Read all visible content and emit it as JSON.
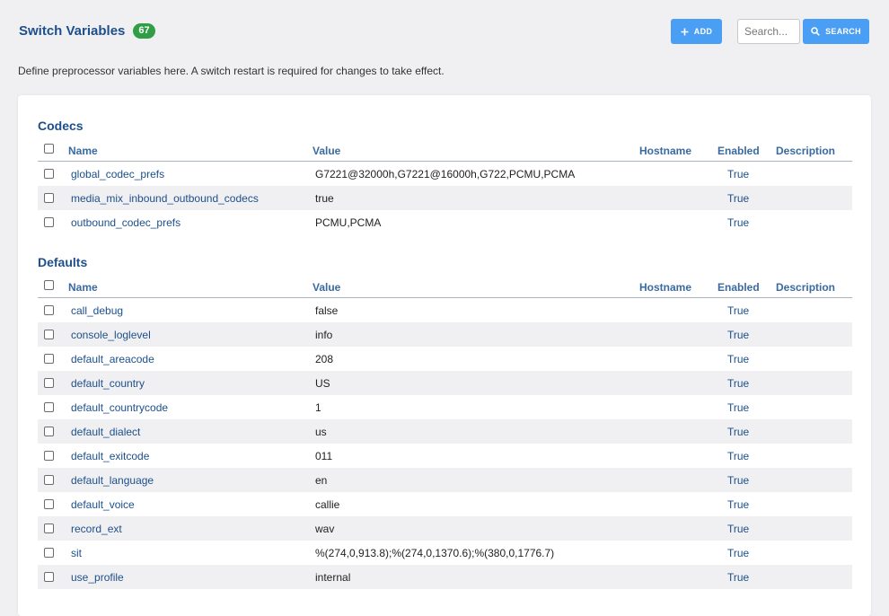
{
  "page": {
    "title": "Switch Variables",
    "count": "67",
    "description": "Define preprocessor variables here. A switch restart is required for changes to take effect."
  },
  "toolbar": {
    "add_label": "ADD",
    "search_placeholder": "Search...",
    "search_value": "",
    "search_label": "SEARCH",
    "accent_color": "#4a9ff5"
  },
  "columns": {
    "name": "Name",
    "value": "Value",
    "hostname": "Hostname",
    "enabled": "Enabled",
    "description": "Description"
  },
  "sections": [
    {
      "title": "Codecs",
      "rows": [
        {
          "name": "global_codec_prefs",
          "value": "G7221@32000h,G7221@16000h,G722,PCMU,PCMA",
          "hostname": "",
          "enabled": "True",
          "description": ""
        },
        {
          "name": "media_mix_inbound_outbound_codecs",
          "value": "true",
          "hostname": "",
          "enabled": "True",
          "description": ""
        },
        {
          "name": "outbound_codec_prefs",
          "value": "PCMU,PCMA",
          "hostname": "",
          "enabled": "True",
          "description": ""
        }
      ]
    },
    {
      "title": "Defaults",
      "rows": [
        {
          "name": "call_debug",
          "value": "false",
          "hostname": "",
          "enabled": "True",
          "description": ""
        },
        {
          "name": "console_loglevel",
          "value": "info",
          "hostname": "",
          "enabled": "True",
          "description": ""
        },
        {
          "name": "default_areacode",
          "value": "208",
          "hostname": "",
          "enabled": "True",
          "description": ""
        },
        {
          "name": "default_country",
          "value": "US",
          "hostname": "",
          "enabled": "True",
          "description": ""
        },
        {
          "name": "default_countrycode",
          "value": "1",
          "hostname": "",
          "enabled": "True",
          "description": ""
        },
        {
          "name": "default_dialect",
          "value": "us",
          "hostname": "",
          "enabled": "True",
          "description": ""
        },
        {
          "name": "default_exitcode",
          "value": "011",
          "hostname": "",
          "enabled": "True",
          "description": ""
        },
        {
          "name": "default_language",
          "value": "en",
          "hostname": "",
          "enabled": "True",
          "description": ""
        },
        {
          "name": "default_voice",
          "value": "callie",
          "hostname": "",
          "enabled": "True",
          "description": ""
        },
        {
          "name": "record_ext",
          "value": "wav",
          "hostname": "",
          "enabled": "True",
          "description": ""
        },
        {
          "name": "sit",
          "value": "%(274,0,913.8);%(274,0,1370.6);%(380,0,1776.7)",
          "hostname": "",
          "enabled": "True",
          "description": ""
        },
        {
          "name": "use_profile",
          "value": "internal",
          "hostname": "",
          "enabled": "True",
          "description": ""
        }
      ]
    }
  ]
}
